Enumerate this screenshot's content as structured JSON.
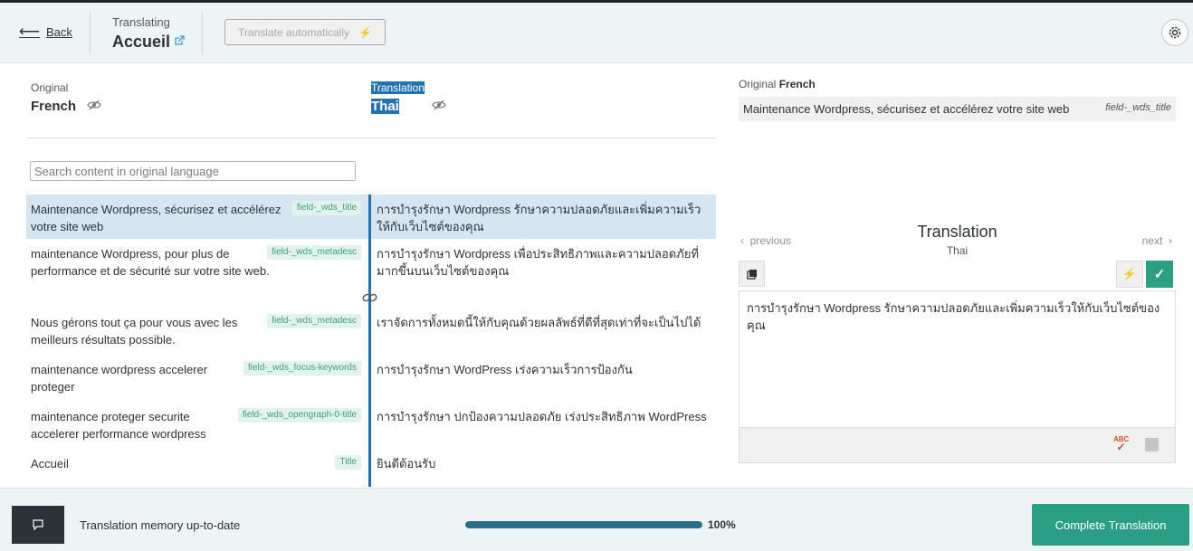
{
  "header": {
    "back_label": "Back",
    "translating_label": "Translating",
    "page_title": "Accueil",
    "auto_translate_label": "Translate automatically"
  },
  "languages": {
    "original_label": "Original",
    "original_lang": "French",
    "translation_label": "Translation",
    "translation_lang": "Thai"
  },
  "search": {
    "placeholder": "Search content in original language"
  },
  "rows": [
    {
      "original": "Maintenance Wordpress, sécurisez et accélérez votre site web",
      "field": "field-_wds_title",
      "translation": "การบำรุงรักษา Wordpress รักษาความปลอดภัยและเพิ่มความเร็วให้กับเว็บไซต์ของคุณ"
    },
    {
      "original": "maintenance Wordpress, pour plus de performance et de sécurité sur votre site web.",
      "field": "field-_wds_metadesc",
      "translation": "การบำรุงรักษา Wordpress เพื่อประสิทธิภาพและความปลอดภัยที่มากขึ้นบนเว็บไซต์ของคุณ"
    },
    {
      "original": "Nous gérons tout ça pour vous avec les meilleurs résultats possible.",
      "field": "field-_wds_metadesc",
      "translation": "เราจัดการทั้งหมดนี้ให้กับคุณด้วยผลลัพธ์ที่ดีที่สุดเท่าที่จะเป็นไปได้"
    },
    {
      "original": "maintenance wordpress accelerer proteger",
      "field": "field-_wds_focus-keywords",
      "translation": "การบำรุงรักษา WordPress เร่งความเร็วการป้องกัน"
    },
    {
      "original": "maintenance proteger securite accelerer performance wordpress",
      "field": "field-_wds_opengraph-0-title",
      "translation": "การบำรุงรักษา ปกป้องความปลอดภัย เร่งประสิทธิภาพ WordPress"
    },
    {
      "original": "Accueil",
      "field": "Title",
      "translation": "ยินดีต้อนรับ"
    }
  ],
  "editor": {
    "original_label": "Original",
    "original_lang": "French",
    "original_text": "Maintenance Wordpress, sécurisez et accélérez votre site web",
    "original_field": "field-_wds_title",
    "previous_label": "previous",
    "next_label": "next",
    "translation_title": "Translation",
    "translation_lang": "Thai",
    "translation_text": "การบำรุงรักษา Wordpress รักษาความปลอดภัยและเพิ่มความเร็วให้กับเว็บไซต์ของคุณ",
    "spellcheck_label": "ABC"
  },
  "footer": {
    "tm_status": "Translation memory up-to-date",
    "progress_percent": 100,
    "progress_label": "100%",
    "complete_label": "Complete Translation"
  },
  "colors": {
    "accent": "#2b9f86",
    "selection": "#2271b1",
    "progress": "#2c6d8c"
  }
}
